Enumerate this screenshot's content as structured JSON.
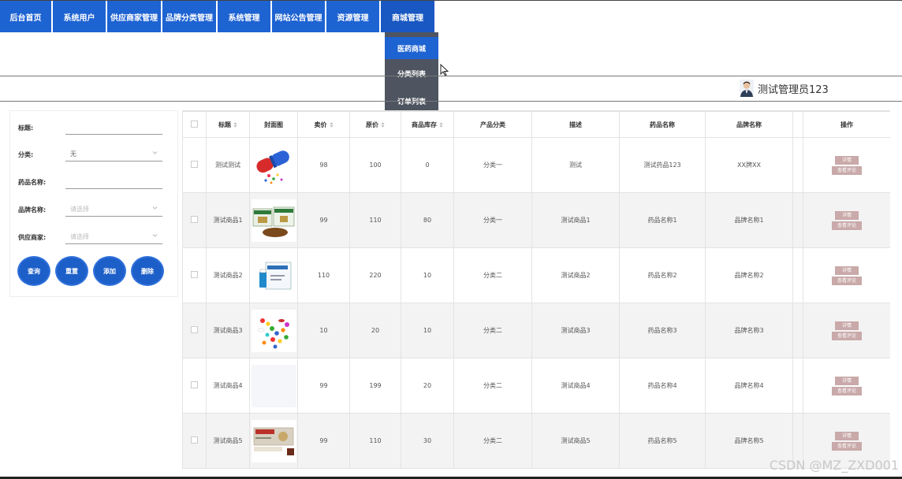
{
  "nav": {
    "items": [
      {
        "label": "后台首页"
      },
      {
        "label": "系统用户"
      },
      {
        "label": "供应商家管理"
      },
      {
        "label": "品牌分类管理"
      },
      {
        "label": "系统管理"
      },
      {
        "label": "网站公告管理"
      },
      {
        "label": "资源管理"
      },
      {
        "label": "商城管理"
      }
    ],
    "dropdown": [
      {
        "label": "医药商城"
      },
      {
        "label": "分类列表"
      },
      {
        "label": "订单列表"
      }
    ]
  },
  "user": {
    "name": "测试管理员123"
  },
  "search": {
    "title_label": "标题:",
    "title_value": "",
    "category_label": "分类:",
    "category_value": "无",
    "drug_label": "药品名称:",
    "drug_value": "",
    "brand_label": "品牌名称:",
    "brand_placeholder": "请选择",
    "supplier_label": "供应商家:",
    "supplier_placeholder": "请选择",
    "buttons": {
      "query": "查询",
      "reset": "重置",
      "add": "添加",
      "delete": "删除"
    }
  },
  "table": {
    "headers": {
      "title": "标题",
      "cover": "封面图",
      "price": "卖价",
      "orig": "原价",
      "stock": "商品库存",
      "category": "产品分类",
      "desc": "描述",
      "drug": "药品名称",
      "brand": "品牌名称",
      "ops": "操作"
    },
    "detail_label": "详情",
    "review_label": "查看评论",
    "rows": [
      {
        "title": "测试测试",
        "price": "98",
        "orig": "100",
        "stock": "0",
        "category": "分类一",
        "desc": "测试",
        "drug": "测试药品123",
        "brand": "XX牌XX"
      },
      {
        "title": "测试商品1",
        "price": "99",
        "orig": "110",
        "stock": "80",
        "category": "分类一",
        "desc": "测试商品1",
        "drug": "药品名称1",
        "brand": "品牌名称1"
      },
      {
        "title": "测试商品2",
        "price": "110",
        "orig": "220",
        "stock": "10",
        "category": "分类二",
        "desc": "测试商品2",
        "drug": "药品名称2",
        "brand": "品牌名称2"
      },
      {
        "title": "测试商品3",
        "price": "10",
        "orig": "20",
        "stock": "10",
        "category": "分类二",
        "desc": "测试商品3",
        "drug": "药品名称3",
        "brand": "品牌名称3"
      },
      {
        "title": "测试商品4",
        "price": "99",
        "orig": "199",
        "stock": "20",
        "category": "分类二",
        "desc": "测试商品4",
        "drug": "药品名称4",
        "brand": "品牌名称4"
      },
      {
        "title": "测试商品5",
        "price": "99",
        "orig": "110",
        "stock": "30",
        "category": "分类二",
        "desc": "测试商品5",
        "drug": "药品名称5",
        "brand": "品牌名称5"
      }
    ]
  },
  "watermark": "CSDN @MZ_ZXD001"
}
